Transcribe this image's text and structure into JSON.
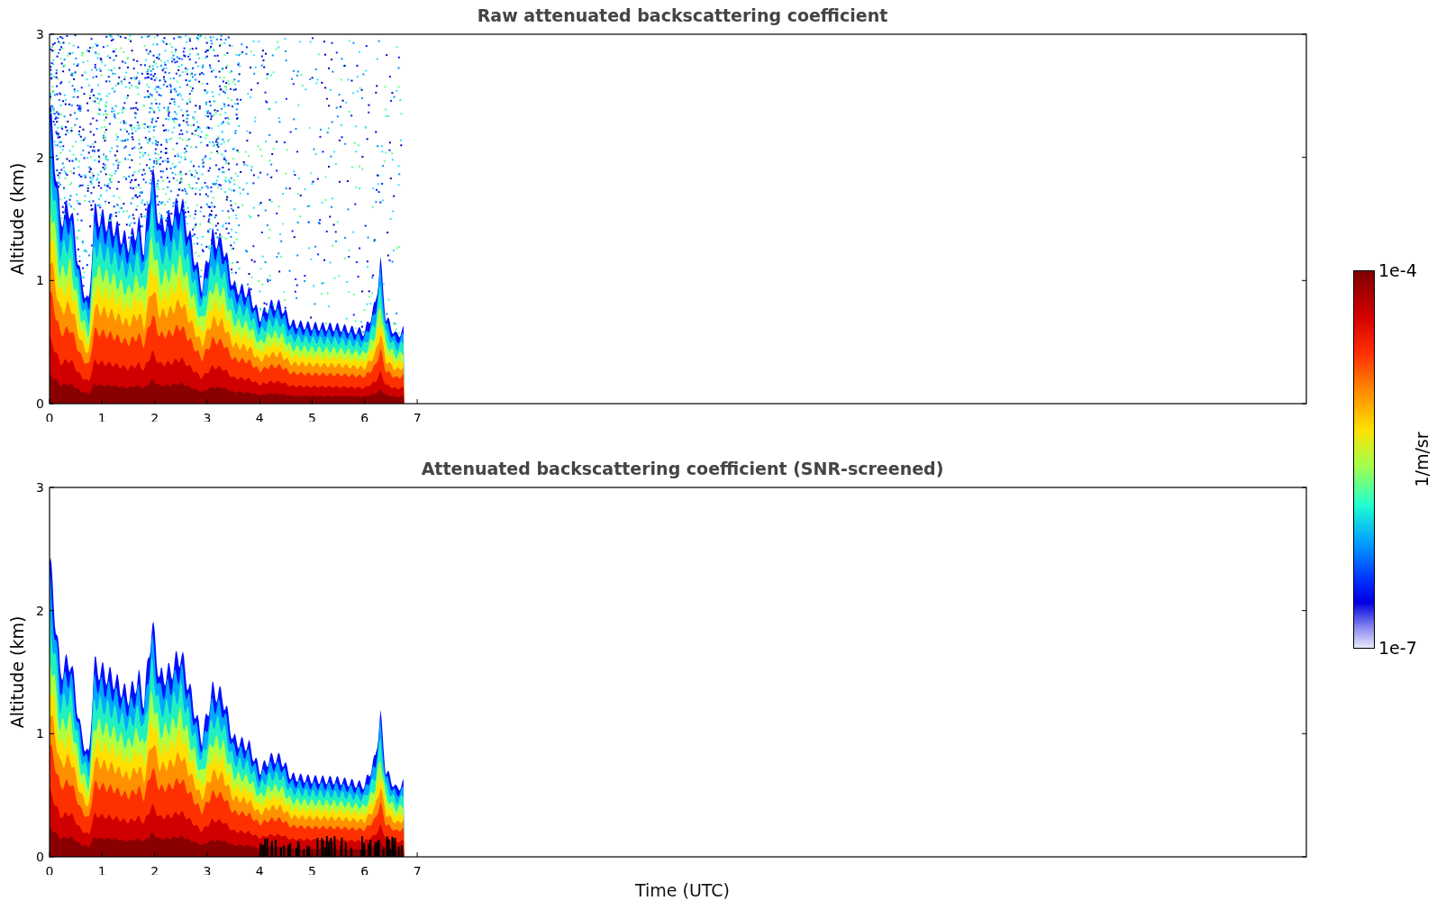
{
  "panels": [
    {
      "title": "Raw attenuated backscattering coefficient",
      "ylabel": "Altitude (km)",
      "yticks": [
        "3",
        "2",
        "1",
        "0"
      ],
      "xticks": [
        "0",
        "1",
        "2",
        "3",
        "4",
        "5",
        "6",
        "7"
      ],
      "screened": false
    },
    {
      "title": "Attenuated backscattering coefficient (SNR-screened)",
      "ylabel": "Altitude (km)",
      "yticks": [
        "3",
        "2",
        "1",
        "0"
      ],
      "xticks": [
        "0",
        "1",
        "2",
        "3",
        "4",
        "5",
        "6",
        "7"
      ],
      "screened": true
    }
  ],
  "xlabel": "Time (UTC)",
  "colorbar": {
    "max_label": "1e-4",
    "min_label": "1e-7",
    "label": "1/m/sr"
  }
}
